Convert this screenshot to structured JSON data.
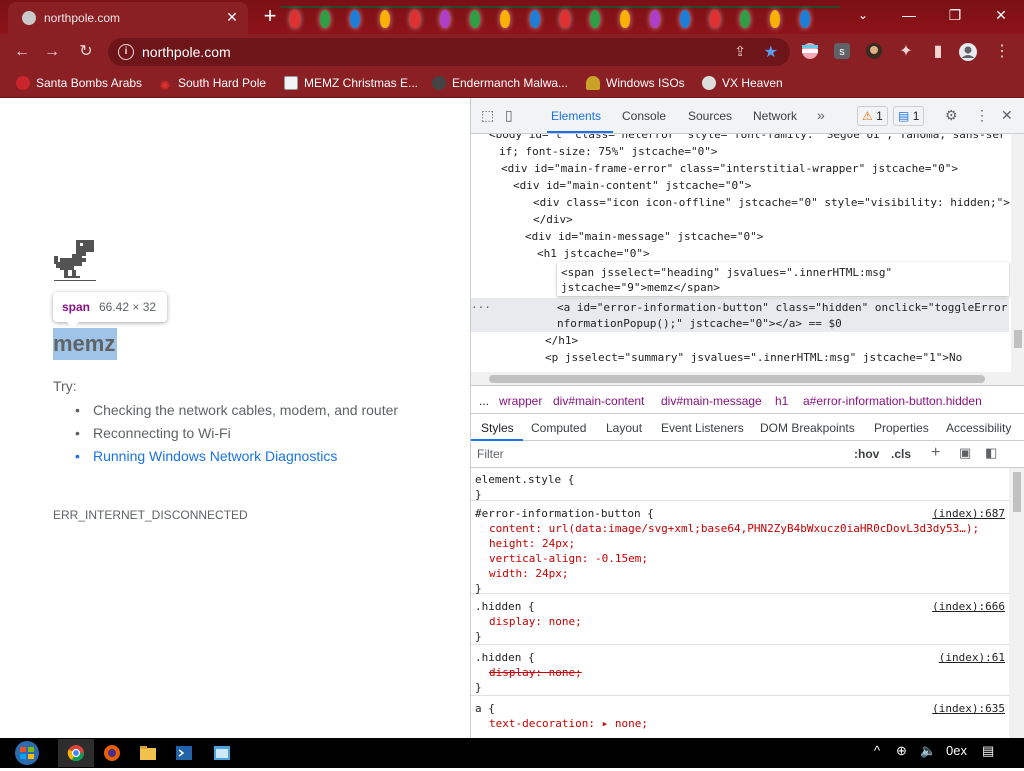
{
  "browser": {
    "tab_title": "northpole.com",
    "url": "northpole.com",
    "bookmarks": [
      {
        "label": "Santa Bombs Arabs",
        "icon": "santa-icon"
      },
      {
        "label": "South Hard Pole",
        "icon": "snowflake-icon"
      },
      {
        "label": "MEMZ Christmas E...",
        "icon": "memz-icon"
      },
      {
        "label": "Endermanch Malwa...",
        "icon": "enderman-icon"
      },
      {
        "label": "Windows ISOs",
        "icon": "windows-icon"
      },
      {
        "label": "VX Heaven",
        "icon": "vx-icon"
      }
    ]
  },
  "page": {
    "tooltip_tag": "span",
    "tooltip_dims": "66.42 × 32",
    "heading": "memz",
    "try_label": "Try:",
    "suggestions": [
      "Checking the network cables, modem, and router",
      "Reconnecting to Wi-Fi",
      "Running Windows Network Diagnostics"
    ],
    "error_code": "ERR_INTERNET_DISCONNECTED"
  },
  "devtools": {
    "tabs": [
      "Elements",
      "Console",
      "Sources",
      "Network"
    ],
    "active_tab": "Elements",
    "warnings": "1",
    "messages": "1",
    "dom_lines": [
      "<body id=\"t\" class=\"neterror\" style=\"font-family: 'Segoe UI', Tahoma, sans-ser",
      "if; font-size: 75%\" jstcache=\"0\">",
      "<div id=\"main-frame-error\" class=\"interstitial-wrapper\" jstcache=\"0\">",
      "<div id=\"main-content\" jstcache=\"0\">",
      "<div class=\"icon icon-offline\" jstcache=\"0\" style=\"visibility: hidden;\">",
      "</div>",
      "<div id=\"main-message\" jstcache=\"0\">",
      "<h1 jstcache=\"0\">",
      "<span jsselect=\"heading\" jsvalues=\".innerHTML:msg\"",
      "jstcache=\"9\">memz</span>",
      "<a id=\"error-information-button\" class=\"hidden\" onclick=\"toggleError",
      "nformationPopup();\" jstcache=\"0\"></a> == $0",
      "</h1>",
      "<p jsselect=\"summary\" jsvalues=\".innerHTML:msg\" jstcache=\"1\">No"
    ],
    "breadcrumbs": [
      "...",
      "wrapper",
      "div#main-content",
      "div#main-message",
      "h1",
      "a#error-information-button.hidden"
    ],
    "sub_tabs": [
      "Styles",
      "Computed",
      "Layout",
      "Event Listeners",
      "DOM Breakpoints",
      "Properties",
      "Accessibility"
    ],
    "filter_placeholder": "Filter",
    "hov": ":hov",
    "cls": ".cls",
    "rules": [
      {
        "selector": "element.style {",
        "source": "",
        "props": [],
        "close": "}"
      },
      {
        "selector": "#error-information-button {",
        "source": "(index):687",
        "props": [
          "content: url(data:image/svg+xml;base64,PHN2ZyB4bWxucz0iaHR0cDovL3d3dy53…);",
          "height: 24px;",
          "vertical-align: -0.15em;",
          "width: 24px;"
        ],
        "close": "}"
      },
      {
        "selector": ".hidden {",
        "source": "(index):666",
        "props": [
          "display: none;"
        ],
        "close": "}"
      },
      {
        "selector": ".hidden {",
        "source": "(index):61",
        "props": [
          "display: none;"
        ],
        "close": "}"
      },
      {
        "selector": "a {",
        "source": "(index):635",
        "props": [
          "text-decoration: ▸ none;"
        ],
        "close": "}"
      }
    ]
  },
  "taskbar": {
    "tray_text": "0ex"
  }
}
